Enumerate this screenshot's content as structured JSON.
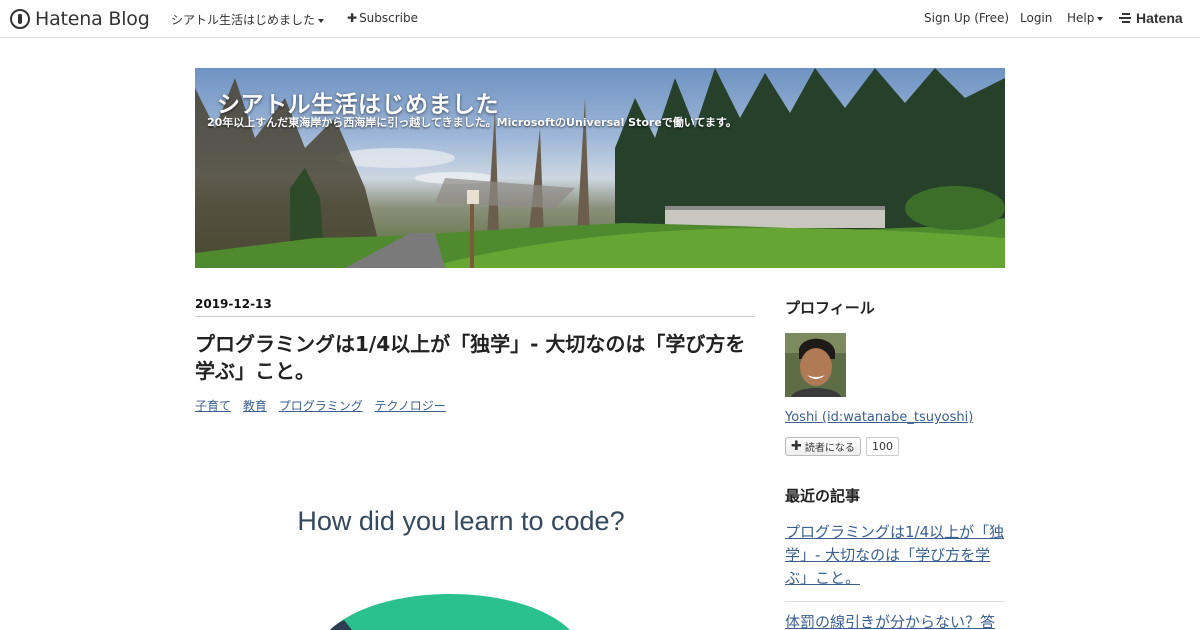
{
  "topbar": {
    "brand": "Hatena Blog",
    "blog_menu": "シアトル生活はじめました",
    "subscribe": "Subscribe",
    "signup": "Sign Up (Free)",
    "login": "Login",
    "help": "Help",
    "hatena": "Hatena"
  },
  "header": {
    "title": "シアトル生活はじめました",
    "description": "20年以上すんだ東海岸から西海岸に引っ越してきました。MicrosoftのUniversal Storeで働いてます。"
  },
  "post": {
    "date": "2019-12-13",
    "title": "プログラミングは1/4以上が「独学」- 大切なのは「学び方を学ぶ」こと。",
    "categories": [
      "子育て",
      "教育",
      "プログラミング",
      "テクノロジー"
    ],
    "figure_title": "How did you learn to code?"
  },
  "sidebar": {
    "profile_heading": "プロフィール",
    "profile_name": "Yoshi (id:watanabe_tsuyoshi)",
    "reader_button": "読者になる",
    "reader_count": "100",
    "recent_heading": "最近の記事",
    "recent": [
      "プログラミングは1/4以上が「独学」- 大切なのは「学び方を学ぶ」こと。",
      "体罰の線引きが分からない？答"
    ]
  },
  "colors": {
    "link": "#3b5f8f",
    "pie_green": "#2ac18f",
    "pie_navy": "#2c3e50"
  }
}
